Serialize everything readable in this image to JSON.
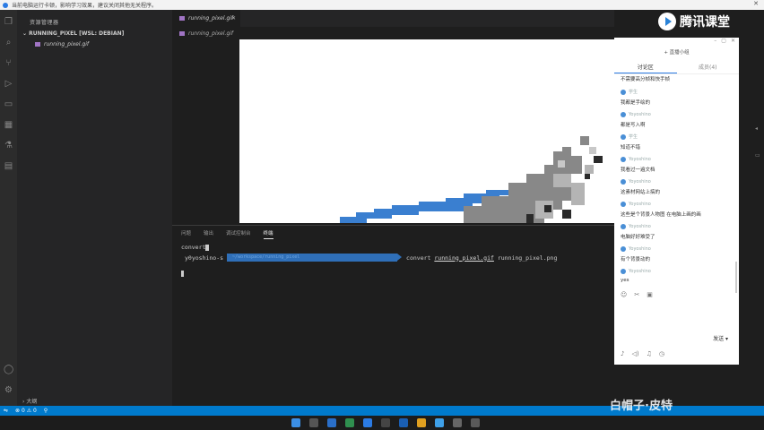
{
  "notice": {
    "text": "当前电脑运行卡顿，影响学习效果，建议关闭其他无关程序。",
    "close": "✕"
  },
  "sidebar": {
    "header": "资源管理器",
    "folder": "RUNNING_PIXEL [WSL: DEBIAN]",
    "file": "running_pixel.gif",
    "outline": "大纲"
  },
  "editor": {
    "tab_label": "running_pixel.gif",
    "breadcrumb": "running_pixel.gif"
  },
  "panel": {
    "tabs": [
      "问题",
      "输出",
      "调试控制台",
      "终端"
    ],
    "active_tab": "终端",
    "line1": "convert",
    "prompt_user": "y0yoshino-s",
    "prompt_path": "~/workspace/running_pixel",
    "command": "convert",
    "arg1": "running_pixel.gif",
    "arg2": "running_pixel.png"
  },
  "brand": {
    "name": "腾讯课堂"
  },
  "chat": {
    "room": "+ 直播小组",
    "tabs": [
      "讨论区",
      "成员(4)"
    ],
    "first_line": "不需要高分帧和快手帧",
    "messages": [
      {
        "user": "学生",
        "text": "我都是手绘的"
      },
      {
        "user": "Yoyoshino",
        "text": "都是写入啊"
      },
      {
        "user": "学生",
        "text": "知道不错"
      },
      {
        "user": "Yoyoshino",
        "text": "我看过一遍文档"
      },
      {
        "user": "Yoyoshino",
        "text": "这素材网站上搞的"
      },
      {
        "user": "Yoyoshino",
        "text": "这些是个背景人物图 在电脑上画的画"
      },
      {
        "user": "Yoyoshino",
        "text": "电脑好好难受了"
      },
      {
        "user": "Yoyoshino",
        "text": "有个背景动的"
      },
      {
        "user": "Yoyoshino",
        "text": "yes"
      }
    ],
    "send_label": "发送"
  },
  "watermark": "白帽子·皮特"
}
